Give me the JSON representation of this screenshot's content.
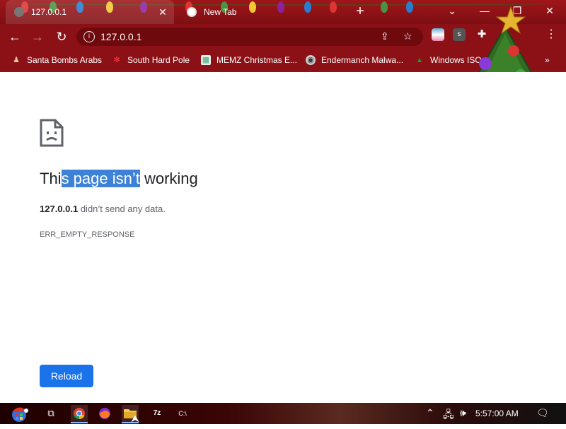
{
  "browser": {
    "tabs": [
      {
        "title": "127.0.0.1",
        "active": true
      },
      {
        "title": "New Tab",
        "active": false
      }
    ],
    "new_tab_symbol": "+",
    "window_controls": {
      "menu": "⌄",
      "minimize": "—",
      "maximize": "❐",
      "close": "✕"
    },
    "address": "127.0.0.1",
    "bookmarks": [
      {
        "label": "Santa Bombs Arabs",
        "icon": "santa-icon"
      },
      {
        "label": "South Hard Pole",
        "icon": "snowflake-icon"
      },
      {
        "label": "MEMZ Christmas E...",
        "icon": "page-icon"
      },
      {
        "label": "Endermanch Malwa...",
        "icon": "raccoon-icon"
      },
      {
        "label": "Windows ISO",
        "icon": "tree-icon"
      }
    ],
    "bookmarks_overflow": "»",
    "extension_label": "s"
  },
  "page": {
    "heading_before": "Thi",
    "heading_selected": "s page isn’t",
    "heading_after": " working",
    "host": "127.0.0.1",
    "message": " didn’t send any data.",
    "error_code": "ERR_EMPTY_RESPONSE",
    "reload_label": "Reload"
  },
  "taskbar": {
    "apps": [
      "start-button",
      "task-view",
      "chrome",
      "firefox",
      "file-explorer",
      "7zip",
      "cmd"
    ],
    "sevenzip_label": "7z",
    "cmd_label": "C:\\",
    "clock": "5:57:00 AM"
  },
  "colors": {
    "chrome_frame": "#8e1418",
    "selection": "#3d82d6",
    "reload_button": "#1a73e8"
  }
}
